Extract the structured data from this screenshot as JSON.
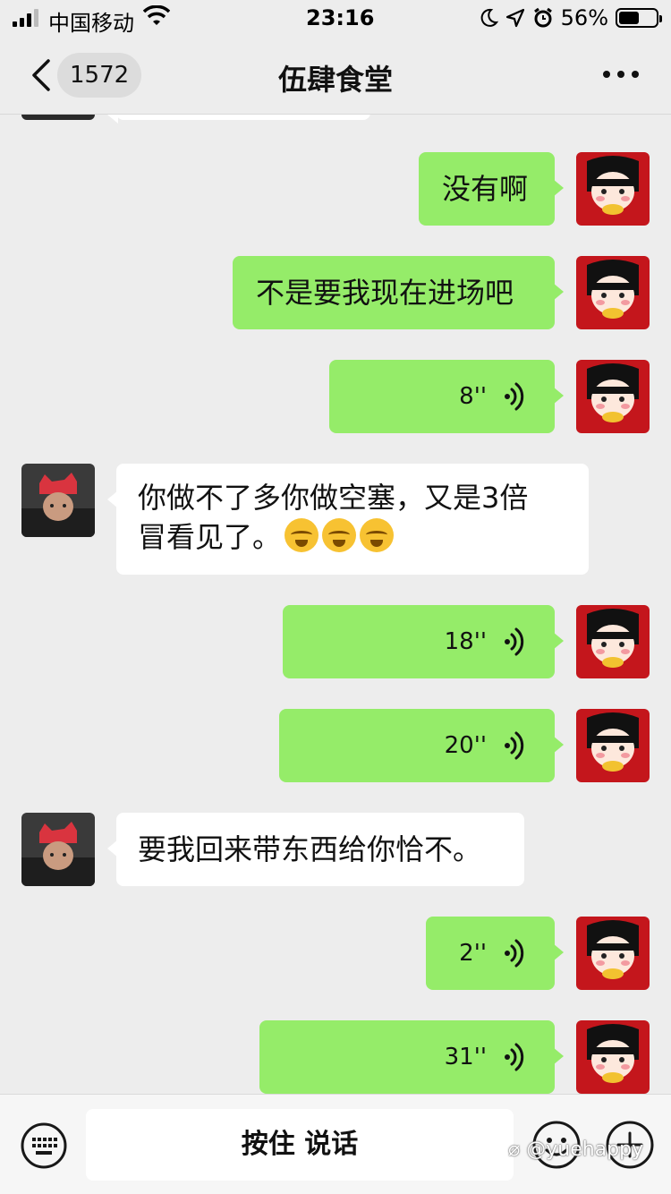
{
  "status_bar": {
    "carrier": "中国移动",
    "time": "23:16",
    "battery_percent": "56%",
    "battery_level": 0.56
  },
  "nav": {
    "unread_count": "1572",
    "title": "伍肆食堂"
  },
  "messages": [
    {
      "type": "text",
      "side": "out",
      "text": "没有啊"
    },
    {
      "type": "text",
      "side": "out",
      "text": "不是要我现在进场吧"
    },
    {
      "type": "voice",
      "side": "out",
      "duration": "8''"
    },
    {
      "type": "text",
      "side": "in",
      "line1": "你做不了多你做空塞，又是3倍",
      "line2": "冒看见了。",
      "emoji_count": 3
    },
    {
      "type": "voice",
      "side": "out",
      "duration": "18''"
    },
    {
      "type": "voice",
      "side": "out",
      "duration": "20''"
    },
    {
      "type": "text",
      "side": "in",
      "text": "要我回来带东西给你恰不。"
    },
    {
      "type": "voice",
      "side": "out",
      "duration": "2''"
    },
    {
      "type": "voice",
      "side": "out",
      "duration": "31''"
    }
  ],
  "input_bar": {
    "hold_to_talk": "按住 说话"
  },
  "watermark": "@yuehappy",
  "colors": {
    "background": "#ededed",
    "outgoing_bubble": "#95ec69",
    "incoming_bubble": "#ffffff"
  },
  "icons": [
    "signal-icon",
    "wifi-icon",
    "moon-icon",
    "location-icon",
    "alarm-icon",
    "battery-icon",
    "back-chevron-icon",
    "more-dots-icon",
    "voice-wave-icon",
    "laughing-tears-emoji",
    "keyboard-icon",
    "emoji-face-icon",
    "plus-icon",
    "weibo-logo-icon"
  ]
}
